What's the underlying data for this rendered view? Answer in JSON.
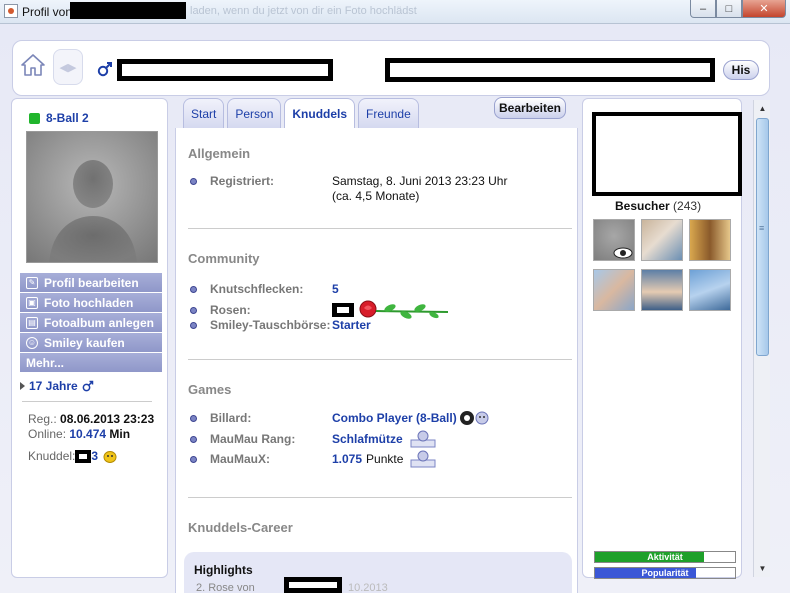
{
  "window": {
    "title": "Profil von",
    "ghost_text": "laden, wenn du jetzt von dir ein Foto hochlädst",
    "close_label": "✕"
  },
  "topbar": {
    "his_label": "His"
  },
  "left": {
    "nickname": "8-Ball 2",
    "menu": [
      {
        "label": "Profil bearbeiten",
        "icon": "edit-icon"
      },
      {
        "label": "Foto hochladen",
        "icon": "photo-icon"
      },
      {
        "label": "Fotoalbum anlegen",
        "icon": "album-icon"
      },
      {
        "label": "Smiley kaufen",
        "icon": "smiley-icon"
      },
      {
        "label": "Mehr...",
        "icon": ""
      }
    ],
    "age": "17 Jahre",
    "reg_label": "Reg.:",
    "reg_value": "08.06.2013 23:23",
    "online_label": "Online:",
    "online_value": "10.474",
    "online_unit": "Min",
    "knuddel_label": "Knuddel:",
    "knuddel_value": "3"
  },
  "tabs": [
    {
      "label": "Start",
      "active": false
    },
    {
      "label": "Person",
      "active": false
    },
    {
      "label": "Knuddels",
      "active": true
    },
    {
      "label": "Freunde",
      "active": false
    }
  ],
  "edit_button": "Bearbeiten",
  "sections": {
    "allgemein": {
      "title": "Allgemein",
      "registriert_label": "Registriert:",
      "registriert_value": "Samstag, 8. Juni 2013 23:23 Uhr",
      "registriert_sub": "(ca. 4,5 Monate)"
    },
    "community": {
      "title": "Community",
      "knutschflecken_label": "Knutschflecken:",
      "knutschflecken_value": "5",
      "rosen_label": "Rosen:",
      "smiley_label": "Smiley-Tauschbörse:",
      "smiley_value": "Starter"
    },
    "games": {
      "title": "Games",
      "billard_label": "Billard:",
      "billard_value": "Combo Player (8-Ball)",
      "maumau_label": "MauMau Rang:",
      "maumau_value": "Schlafmütze",
      "maumaux_label": "MauMauX:",
      "maumaux_value": "1.075",
      "maumaux_unit": "Punkte"
    },
    "career": {
      "title": "Knuddels-Career"
    },
    "highlights": {
      "title": "Highlights",
      "partial_text": "2. Rose von",
      "partial_date": "10.2013"
    }
  },
  "right": {
    "visitors_label": "Besucher",
    "visitors_count": "(243)",
    "aktivitaet_label": "Aktivität",
    "aktivitaet_level": 0.78,
    "popularitaet_label": "Popularität",
    "popularitaet_level": 0.72
  },
  "colors": {
    "accent_blue": "#1d3fa8",
    "menu_purple": "#9aa1d1",
    "online_green": "#21b52c",
    "activity_green": "#1ea02a",
    "popularity_blue": "#3b57d6"
  }
}
